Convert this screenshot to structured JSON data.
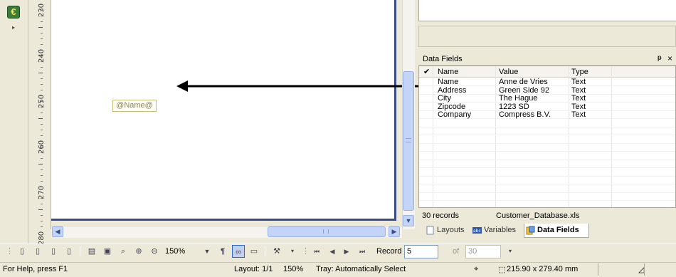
{
  "toolbox": {
    "euro_icon": "euro-icon",
    "expand_icon": "expand-arrow-icon",
    "euro_glyph": "€",
    "expand_glyph": "▸"
  },
  "ruler": {
    "labels": [
      "230",
      "240",
      "250",
      "260",
      "270",
      "280"
    ]
  },
  "canvas": {
    "field_text": "@Name@"
  },
  "data_fields_panel": {
    "title": "Data Fields",
    "pin_glyph": "ᵽ",
    "close_glyph": "×",
    "columns": [
      "Name",
      "Value",
      "Type"
    ],
    "check_glyph": "✔",
    "rows": [
      {
        "name": "Name",
        "value": "Anne de Vries",
        "type": "Text"
      },
      {
        "name": "Address",
        "value": "Green Side 92",
        "type": "Text"
      },
      {
        "name": "City",
        "value": "The Hague",
        "type": "Text"
      },
      {
        "name": "Zipcode",
        "value": "1223 SD",
        "type": "Text"
      },
      {
        "name": "Company",
        "value": "Compress B.V.",
        "type": "Text"
      }
    ],
    "records": "30 records",
    "source_file": "Customer_Database.xls"
  },
  "tabs": [
    {
      "label": "Layouts",
      "icon": "page-icon"
    },
    {
      "label": "Variables",
      "icon": "abc-icon"
    },
    {
      "label": "Data Fields",
      "icon": "database-icon",
      "active": true
    }
  ],
  "toolbar": {
    "zoom": "150%",
    "pilcrow": "¶",
    "record_label": "Record",
    "record_value": "5",
    "of_label": "of",
    "of_value": "30"
  },
  "statusbar": {
    "help": "For Help, press F1",
    "layout": "Layout: 1/1",
    "zoom": "150%",
    "tray": "Tray: Automatically Select",
    "page_size": "215.90 x 279.40 mm"
  },
  "colors": {
    "accent": "#316ac5",
    "page_border": "#3a4a8a",
    "scroll_thumb": "#c4d4f7"
  }
}
